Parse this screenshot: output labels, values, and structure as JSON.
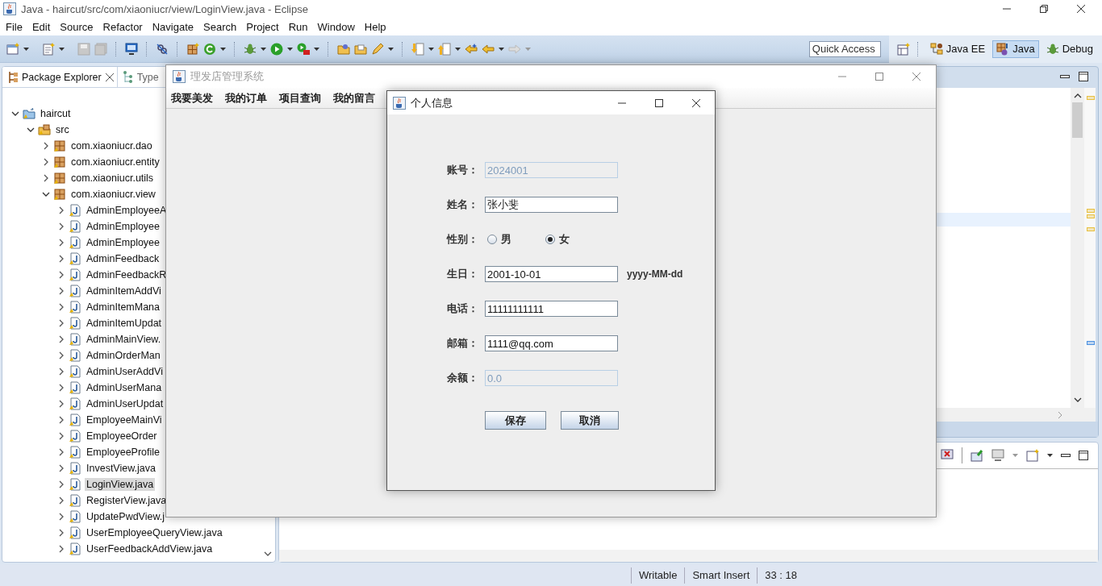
{
  "window": {
    "title": "Java - haircut/src/com/xiaoniucr/view/LoginView.java - Eclipse"
  },
  "menu": [
    "File",
    "Edit",
    "Source",
    "Refactor",
    "Navigate",
    "Search",
    "Project",
    "Run",
    "Window",
    "Help"
  ],
  "quick_access": {
    "placeholder": "Quick Access"
  },
  "perspectives": [
    {
      "label": "Java EE",
      "selected": false
    },
    {
      "label": "Java",
      "selected": true
    },
    {
      "label": "Debug",
      "selected": false
    }
  ],
  "explorer": {
    "tabs": [
      {
        "label": "Package Explorer",
        "selected": true
      },
      {
        "label": "Type",
        "selected": false
      }
    ],
    "tree": [
      {
        "label": "haircut",
        "kind": "project",
        "expanded": true,
        "selected": false,
        "children": [
          {
            "label": "src",
            "kind": "folder",
            "expanded": true,
            "selected": false,
            "children": [
              {
                "label": "com.xiaoniucr.dao",
                "kind": "package",
                "expanded": false,
                "selected": false
              },
              {
                "label": "com.xiaoniucr.entity",
                "kind": "package",
                "expanded": false,
                "selected": false
              },
              {
                "label": "com.xiaoniucr.utils",
                "kind": "package",
                "expanded": false,
                "selected": false
              },
              {
                "label": "com.xiaoniucr.view",
                "kind": "package",
                "expanded": true,
                "selected": false,
                "children": [
                  {
                    "label": "AdminEmployeeA",
                    "kind": "file",
                    "expanded": false,
                    "selected": false
                  },
                  {
                    "label": "AdminEmployee",
                    "kind": "file",
                    "expanded": false,
                    "selected": false
                  },
                  {
                    "label": "AdminEmployee",
                    "kind": "file",
                    "expanded": false,
                    "selected": false
                  },
                  {
                    "label": "AdminFeedback",
                    "kind": "file",
                    "expanded": false,
                    "selected": false
                  },
                  {
                    "label": "AdminFeedbackR",
                    "kind": "file",
                    "expanded": false,
                    "selected": false
                  },
                  {
                    "label": "AdminItemAddVi",
                    "kind": "file",
                    "expanded": false,
                    "selected": false
                  },
                  {
                    "label": "AdminItemMana",
                    "kind": "file",
                    "expanded": false,
                    "selected": false
                  },
                  {
                    "label": "AdminItemUpdat",
                    "kind": "file",
                    "expanded": false,
                    "selected": false
                  },
                  {
                    "label": "AdminMainView.",
                    "kind": "file",
                    "expanded": false,
                    "selected": false
                  },
                  {
                    "label": "AdminOrderMan",
                    "kind": "file",
                    "expanded": false,
                    "selected": false
                  },
                  {
                    "label": "AdminUserAddVi",
                    "kind": "file",
                    "expanded": false,
                    "selected": false
                  },
                  {
                    "label": "AdminUserMana",
                    "kind": "file",
                    "expanded": false,
                    "selected": false
                  },
                  {
                    "label": "AdminUserUpdat",
                    "kind": "file",
                    "expanded": false,
                    "selected": false
                  },
                  {
                    "label": "EmployeeMainVi",
                    "kind": "file",
                    "expanded": false,
                    "selected": false
                  },
                  {
                    "label": "EmployeeOrder",
                    "kind": "file",
                    "expanded": false,
                    "selected": false
                  },
                  {
                    "label": "EmployeeProfile",
                    "kind": "file",
                    "expanded": false,
                    "selected": false
                  },
                  {
                    "label": "InvestView.java",
                    "kind": "file",
                    "expanded": false,
                    "selected": false
                  },
                  {
                    "label": "LoginView.java",
                    "kind": "file",
                    "expanded": false,
                    "selected": true
                  },
                  {
                    "label": "RegisterView.java",
                    "kind": "file",
                    "expanded": false,
                    "selected": false
                  },
                  {
                    "label": "UpdatePwdView.j",
                    "kind": "file",
                    "expanded": false,
                    "selected": false
                  },
                  {
                    "label": "UserEmployeeQueryView.java",
                    "kind": "file",
                    "expanded": false,
                    "selected": false
                  },
                  {
                    "label": "UserFeedbackAddView.java",
                    "kind": "file",
                    "expanded": false,
                    "selected": false
                  }
                ]
              }
            ]
          }
        ]
      }
    ]
  },
  "status_bar": [
    "Writable",
    "Smart Insert",
    "33 : 18"
  ],
  "frame": {
    "title": "理发店管理系统",
    "menu": [
      "我要美发",
      "我的订单",
      "项目查询",
      "我的留言"
    ]
  },
  "dialog": {
    "title": "个人信息",
    "fields": [
      {
        "kind": "text",
        "label": "账号：",
        "value": "2024001",
        "disabled": true
      },
      {
        "kind": "text",
        "label": "姓名：",
        "value": "张小斐",
        "disabled": false
      },
      {
        "kind": "radio",
        "label": "性别：",
        "options": [
          {
            "label": "男",
            "selected": false
          },
          {
            "label": "女",
            "selected": true
          }
        ]
      },
      {
        "kind": "text",
        "label": "生日：",
        "value": "2001-10-01",
        "disabled": false,
        "hint": "yyyy-MM-dd"
      },
      {
        "kind": "text",
        "label": "电话：",
        "value": "11111111111",
        "disabled": false
      },
      {
        "kind": "text",
        "label": "邮箱：",
        "value": "1111@qq.com",
        "disabled": false
      },
      {
        "kind": "text",
        "label": "余额：",
        "value": "0.0",
        "disabled": true
      }
    ],
    "buttons": [
      "保存",
      "取消"
    ]
  }
}
